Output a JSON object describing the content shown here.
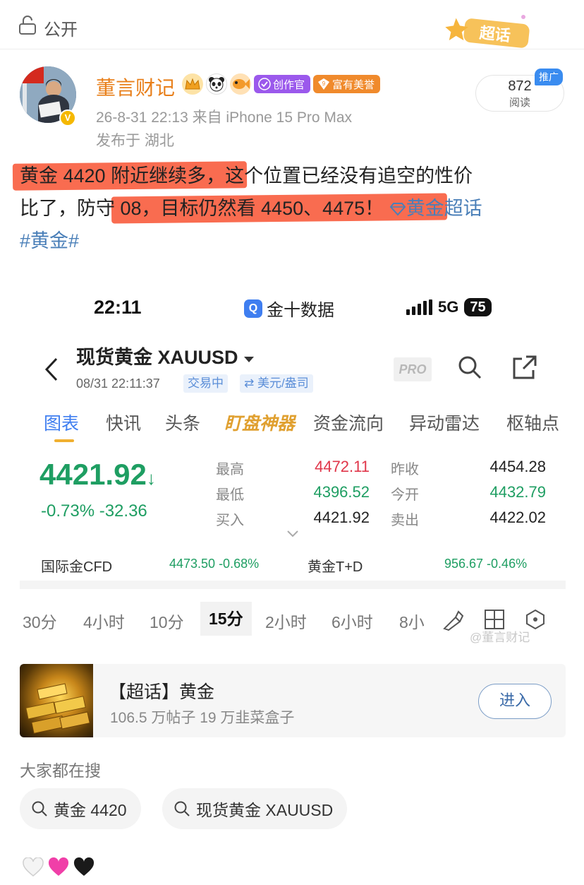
{
  "topbar": {
    "visibility": "公开",
    "supertopic_label": "超话"
  },
  "author": {
    "name": "董言财记",
    "tags": [
      "创作官",
      "富有美誉"
    ],
    "tag_icons": [
      "crown-icon",
      "panda-icon",
      "fish-icon"
    ],
    "time_source": "26-8-31 22:13  来自 iPhone 15 Pro Max",
    "location": "发布于 湖北",
    "reads_count": "872",
    "reads_label": "阅读",
    "promo_label": "推广"
  },
  "post": {
    "line1_hl": "黄金 4420 附近继续多，",
    "line1_rest": "这个位置已经没有追空的性价",
    "line2_pre": "比了，",
    "line2_hl": "防守 08，目标仍然看 4450、4475！",
    "line2_link": "黄金超话",
    "line3_hashtag": "#黄金#"
  },
  "screenshot": {
    "status_time": "22:11",
    "status_app": "金十数据",
    "status_network": "5G",
    "status_battery": "75",
    "symbol_title": "现货黄金  XAUUSD",
    "symbol_datetime": "08/31 22:11:37",
    "chip_trading": "交易中",
    "chip_unit": "⇄ 美元/盎司",
    "pro_label": "PRO",
    "tabs": [
      "图表",
      "快讯",
      "头条",
      "盯盘神器",
      "资金流向",
      "异动雷达",
      "枢轴点"
    ],
    "price": "4421.92",
    "price_arrow": "↓",
    "change": "-0.73%  -32.36",
    "quotes": {
      "high_label": "最高",
      "high": "4472.11",
      "low_label": "最低",
      "low": "4396.52",
      "bid_label": "买入",
      "bid": "4421.92",
      "prev_label": "昨收",
      "prev": "4454.28",
      "open_label": "今开",
      "open": "4432.79",
      "ask_label": "卖出",
      "ask": "4422.02"
    },
    "cfd": {
      "label1": "国际金CFD",
      "value1": "4473.50  -0.68%",
      "label2": "黄金T+D",
      "value2": "956.67  -0.46%"
    },
    "periods": [
      "30分",
      "4小时",
      "10分",
      "15分",
      "2小时",
      "6小时",
      "8小"
    ],
    "active_period": "15分",
    "watermark": "@董言财记"
  },
  "card": {
    "title": "【超话】黄金",
    "subtitle": "106.5 万帖子  19 万韭菜盒子",
    "button": "进入"
  },
  "search": {
    "title": "大家都在搜",
    "items": [
      "黄金 4420",
      "现货黄金 XAUUSD"
    ]
  },
  "colors": {
    "author": "#e87f1a",
    "link": "#4a7fb8",
    "highlight": "#f96c50",
    "up_red": "#e0364a",
    "down_green": "#1e9e62",
    "accent_blue": "#3f7ef0"
  }
}
